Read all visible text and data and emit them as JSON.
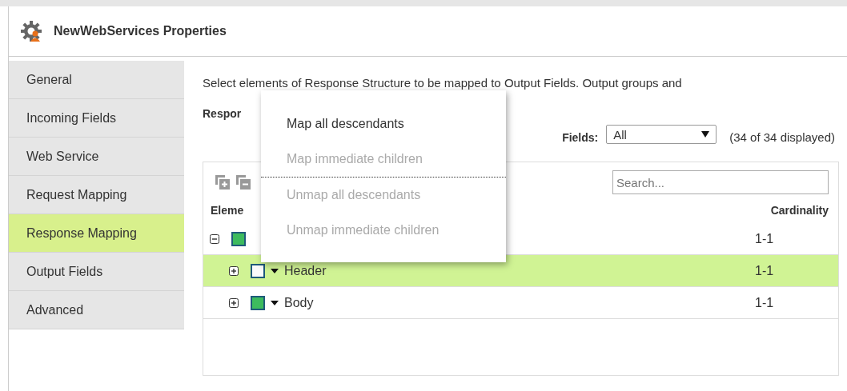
{
  "window": {
    "title": "NewWebServices Properties"
  },
  "sidebar": {
    "items": [
      {
        "label": "General",
        "selected": false
      },
      {
        "label": "Incoming Fields",
        "selected": false
      },
      {
        "label": "Web Service",
        "selected": false
      },
      {
        "label": "Request Mapping",
        "selected": false
      },
      {
        "label": "Response Mapping",
        "selected": true
      },
      {
        "label": "Output Fields",
        "selected": false
      },
      {
        "label": "Advanced",
        "selected": false
      }
    ]
  },
  "description": "Select elements of Response Structure to be mapped to Output Fields. Output groups and",
  "structure_label": "Respor",
  "fields_filter": {
    "label": "Fields:",
    "value": "All",
    "count": "(34 of 34 displayed)"
  },
  "search": {
    "placeholder": "Search..."
  },
  "tree": {
    "columns": [
      "Eleme",
      "Cardinality"
    ],
    "rows": [
      {
        "cardinality": "1-1",
        "checked": true,
        "expanded": true,
        "selected": false,
        "children": [
          {
            "name": "Header",
            "cardinality": "1-1",
            "checked": false,
            "expanded": false,
            "selected": true
          },
          {
            "name": "Body",
            "cardinality": "1-1",
            "checked": true,
            "expanded": false,
            "selected": false
          }
        ]
      }
    ]
  },
  "context_menu": {
    "items": [
      {
        "label": "Map all descendants",
        "disabled": false,
        "separator_after": false
      },
      {
        "label": "Map immediate children",
        "disabled": true,
        "separator_after": true
      },
      {
        "label": "Unmap all descendants",
        "disabled": true,
        "separator_after": false
      },
      {
        "label": "Unmap immediate children",
        "disabled": true,
        "separator_after": false
      }
    ]
  }
}
